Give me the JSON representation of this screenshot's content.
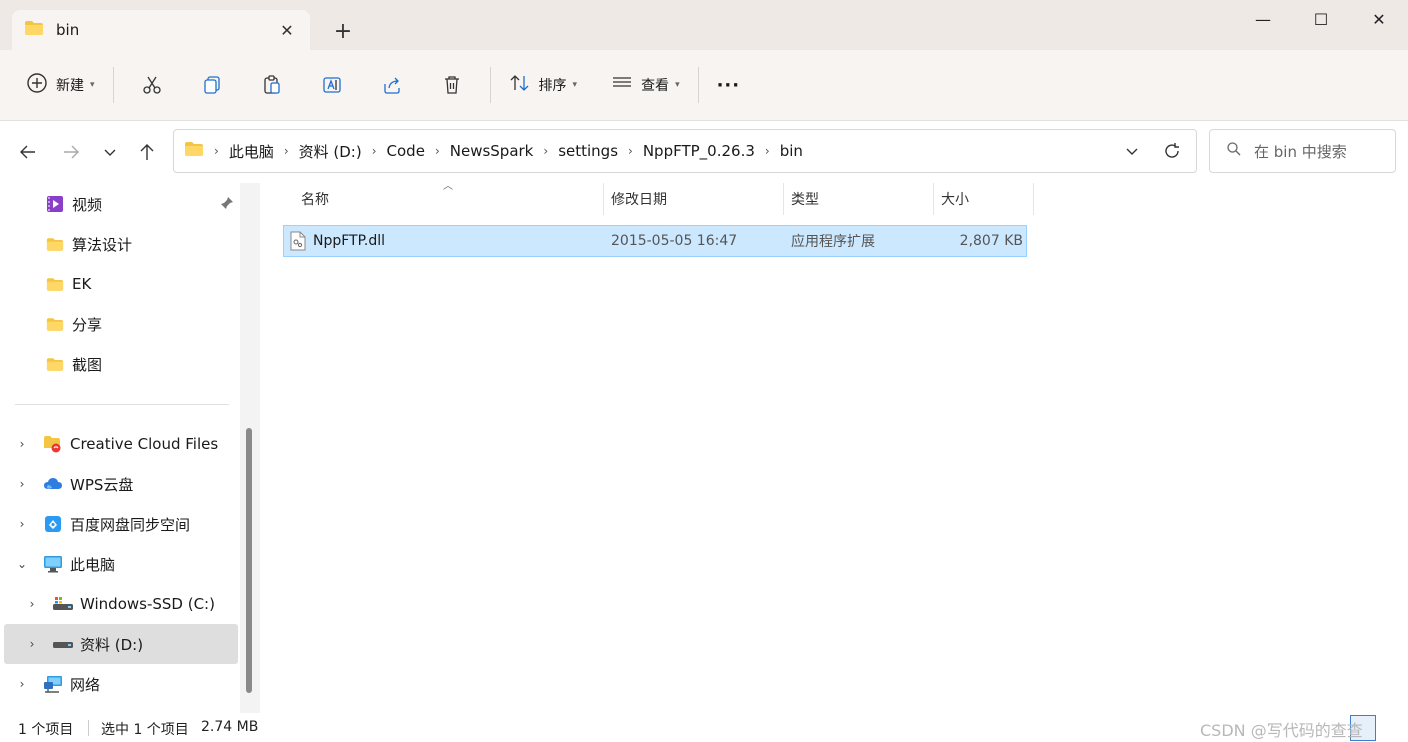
{
  "window": {
    "tab_title": "bin",
    "new_tab_label": "+",
    "controls": {
      "minimize": "—",
      "maximize": "☐",
      "close": "✕"
    }
  },
  "commandbar": {
    "new_label": "新建",
    "sort_label": "排序",
    "view_label": "查看",
    "more_label": "···"
  },
  "address": {
    "crumbs": [
      "此电脑",
      "资料 (D:)",
      "Code",
      "NewsSpark",
      "settings",
      "NppFTP_0.26.3",
      "bin"
    ],
    "search_placeholder": "在 bin 中搜索"
  },
  "sidebar": {
    "quick_items": [
      {
        "label": "视频",
        "icon": "video-icon",
        "pinned": true
      },
      {
        "label": "算法设计",
        "icon": "folder-icon"
      },
      {
        "label": "EK",
        "icon": "folder-icon"
      },
      {
        "label": "分享",
        "icon": "folder-icon"
      },
      {
        "label": "截图",
        "icon": "folder-icon"
      }
    ],
    "tree_items": [
      {
        "label": "Creative Cloud Files",
        "icon": "creative-cloud-icon"
      },
      {
        "label": "WPS云盘",
        "icon": "wps-cloud-icon"
      },
      {
        "label": "百度网盘同步空间",
        "icon": "baidu-netdisk-icon"
      },
      {
        "label": "此电脑",
        "icon": "computer-icon",
        "expanded": true
      },
      {
        "label": "Windows-SSD (C:)",
        "icon": "drive-c-icon"
      },
      {
        "label": "资料 (D:)",
        "icon": "drive-d-icon",
        "selected": true
      },
      {
        "label": "网络",
        "icon": "network-icon"
      }
    ]
  },
  "filelist": {
    "columns": {
      "name": "名称",
      "modified": "修改日期",
      "type": "类型",
      "size": "大小"
    },
    "rows": [
      {
        "name": "NppFTP.dll",
        "modified": "2015-05-05 16:47",
        "type": "应用程序扩展",
        "size": "2,807 KB"
      }
    ]
  },
  "status": {
    "count": "1 个项目",
    "selected": "选中 1 个项目",
    "selected_size": "2.74 MB",
    "watermark": "CSDN @写代码的查查"
  },
  "colors": {
    "title_bg": "#efe9e6",
    "toolbar_bg": "#f8f4f2",
    "selection_bg": "#cce8ff",
    "selection_border": "#99d1ff",
    "folder": "#f4c542"
  }
}
